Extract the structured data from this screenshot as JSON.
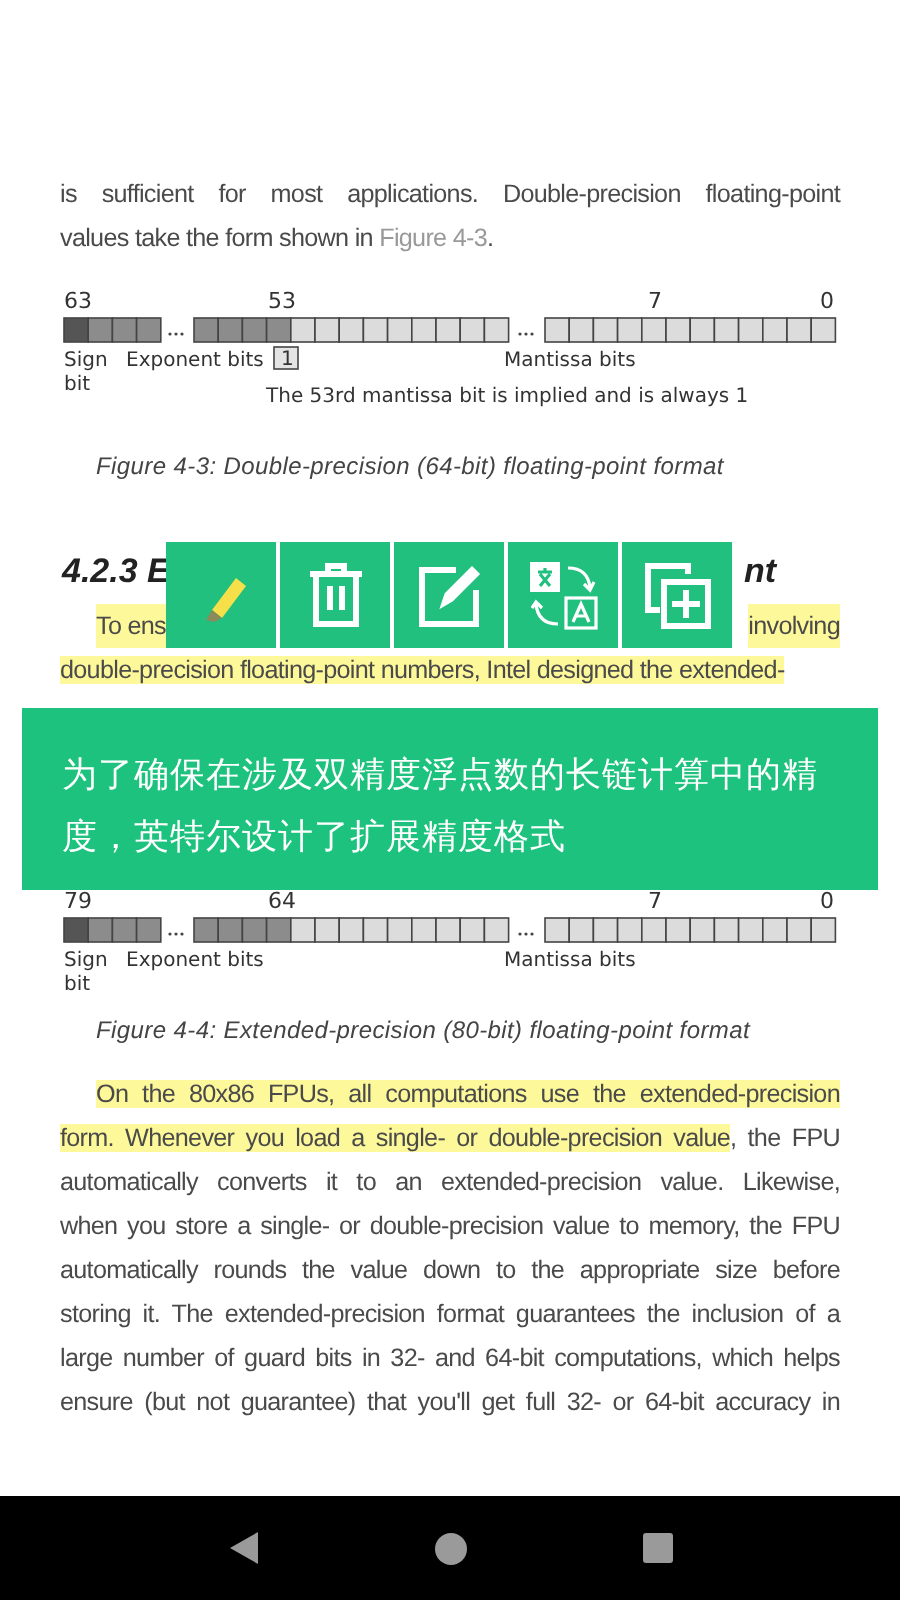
{
  "content": [
    {
      "kind": "paragraph",
      "indented": false,
      "lines": [
        [
          {
            "text": "is sufficient for most applications. Double-precision floating-point",
            "highlighted": false
          }
        ],
        [
          {
            "text": "values take the form shown in ",
            "highlighted": false
          },
          {
            "text": "Figure 4-3",
            "highlighted": false,
            "kind": "link"
          },
          {
            "text": ".",
            "highlighted": false
          }
        ]
      ]
    },
    {
      "kind": "figure",
      "bit_numbers": [
        "63",
        "53",
        "7",
        "0"
      ],
      "sign_label": [
        "Sign",
        "bit"
      ],
      "exponent_label": "Exponent bits",
      "mantissa_label": "Mantissa bits",
      "note_marker": "1",
      "note": "The 53rd mantissa bit is implied and is always 1"
    },
    {
      "kind": "caption",
      "text": "Figure 4-3: Double-precision (64-bit) floating-point format"
    },
    {
      "kind": "heading",
      "parts": [
        "4.2.3 E",
        "nt"
      ]
    },
    {
      "kind": "paragraph",
      "indented": true,
      "lines": [
        [
          {
            "text": "To ens",
            "highlighted": true
          },
          {
            "text": "involving",
            "highlighted": true
          }
        ],
        [
          {
            "text": "double-precision floating-point numbers, Intel designed the extended-",
            "highlighted": true
          }
        ]
      ]
    },
    {
      "kind": "figure",
      "bit_numbers": [
        "79",
        "64",
        "7",
        "0"
      ],
      "sign_label": [
        "Sign",
        "bit"
      ],
      "exponent_label": "Exponent bits",
      "mantissa_label": "Mantissa bits"
    },
    {
      "kind": "caption",
      "text": "Figure 4-4: Extended-precision (80-bit) floating-point format"
    },
    {
      "kind": "paragraph",
      "indented": true,
      "lines": [
        [
          {
            "text": "On the 80x86 FPUs, all computations use the extended-precision",
            "highlighted": true
          }
        ],
        [
          {
            "text": "form. Whenever you load a single- or double-precision value",
            "highlighted": true
          },
          {
            "text": ", the FPU",
            "highlighted": false
          }
        ],
        [
          {
            "text": "automatically converts it to an extended-precision value. Likewise,",
            "highlighted": false
          }
        ],
        [
          {
            "text": "when you store a single- or double-precision value to memory, the FPU",
            "highlighted": false
          }
        ],
        [
          {
            "text": "automatically rounds the value down to the appropriate size before",
            "highlighted": false
          }
        ],
        [
          {
            "text": "storing it. The extended-precision format guarantees the inclusion of a",
            "highlighted": false
          }
        ],
        [
          {
            "text": "large number of guard bits in 32- and 64-bit computations, which helps",
            "highlighted": false
          }
        ],
        [
          {
            "text": "ensure (but not guarantee) that you'll get full 32- or 64-bit accuracy in",
            "highlighted": false
          }
        ]
      ]
    }
  ],
  "toolbar": [
    {
      "kind": "highlight"
    },
    {
      "kind": "delete"
    },
    {
      "kind": "edit"
    },
    {
      "kind": "translate"
    },
    {
      "kind": "copy"
    }
  ],
  "translation": {
    "text": "为了确保在涉及双精度浮点数的长链计算中的精度，英特尔设计了扩展精度格式"
  },
  "nav_bar": [
    {
      "kind": "back"
    },
    {
      "kind": "home"
    },
    {
      "kind": "recents"
    }
  ]
}
